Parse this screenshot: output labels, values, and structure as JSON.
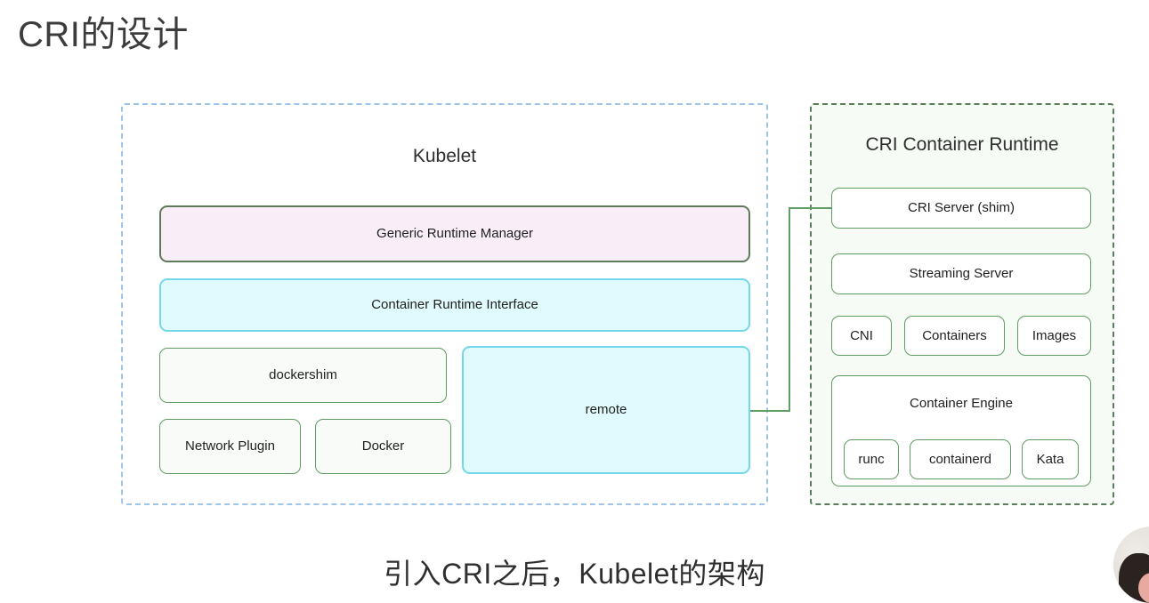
{
  "page": {
    "title": "CRI的设计",
    "caption": "引入CRI之后，Kubelet的架构"
  },
  "diagram": {
    "type": "architecture-block-diagram",
    "panels": [
      {
        "id": "kubelet",
        "title": "Kubelet",
        "border_style": "dashed",
        "border_color": "#9fc6e8",
        "background": "#ffffff",
        "nodes": [
          {
            "id": "generic-runtime-manager",
            "label": "Generic Runtime Manager",
            "fill": "#f9eef8",
            "border": "#5f7a5a"
          },
          {
            "id": "container-runtime-interface",
            "label": "Container Runtime Interface",
            "fill": "#e0fbfd",
            "border": "#74d7ea"
          },
          {
            "id": "dockershim",
            "label": "dockershim",
            "fill": "#f8fbf8",
            "border": "#5f9e62"
          },
          {
            "id": "network-plugin",
            "label": "Network Plugin",
            "fill": "#f8fbf8",
            "border": "#5f9e62"
          },
          {
            "id": "docker",
            "label": "Docker",
            "fill": "#f8fbf8",
            "border": "#5f9e62"
          },
          {
            "id": "remote",
            "label": "remote",
            "fill": "#e0fbfd",
            "border": "#74d7ea"
          }
        ]
      },
      {
        "id": "cri-container-runtime",
        "title": "CRI Container Runtime",
        "border_style": "dashed",
        "border_color": "#5a7d5a",
        "background": "#f7fbf6",
        "nodes": [
          {
            "id": "cri-server",
            "label": "CRI Server (shim)",
            "fill": "#ffffff",
            "border": "#5f9e62"
          },
          {
            "id": "streaming-server",
            "label": "Streaming Server",
            "fill": "#ffffff",
            "border": "#5f9e62"
          },
          {
            "id": "cni",
            "label": "CNI",
            "fill": "#ffffff",
            "border": "#5f9e62"
          },
          {
            "id": "containers",
            "label": "Containers",
            "fill": "#ffffff",
            "border": "#5f9e62"
          },
          {
            "id": "images",
            "label": "Images",
            "fill": "#ffffff",
            "border": "#5f9e62"
          },
          {
            "id": "container-engine",
            "label": "Container Engine",
            "fill": "#ffffff",
            "border": "#5f9e62"
          },
          {
            "id": "runc",
            "label": "runc",
            "fill": "#ffffff",
            "border": "#5f9e62"
          },
          {
            "id": "containerd",
            "label": "containerd",
            "fill": "#ffffff",
            "border": "#5f9e62"
          },
          {
            "id": "kata",
            "label": "Kata",
            "fill": "#ffffff",
            "border": "#5f9e62"
          }
        ]
      }
    ],
    "connectors": [
      {
        "id": "remote-to-cri-server",
        "from": "remote",
        "to": "cri-server",
        "color": "#5f9e62",
        "style": "orthogonal-elbow"
      }
    ]
  }
}
